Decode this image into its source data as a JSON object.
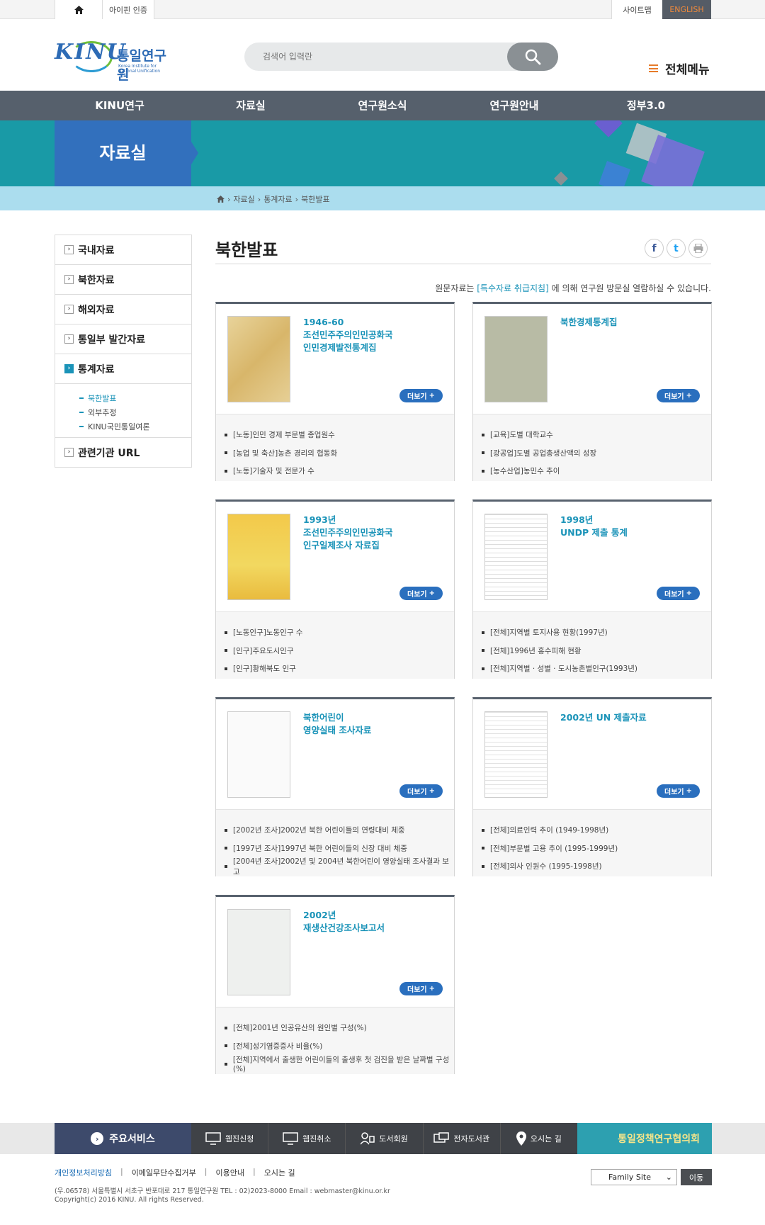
{
  "topbar": {
    "ipin": "아이핀 인증",
    "sitemap": "사이트맵",
    "english": "ENGLISH"
  },
  "header": {
    "logo_text": "KINU",
    "logo_name": "통일연구원",
    "logo_sub": "Korea Institute for National Unification",
    "search_placeholder": "검색어 입력란",
    "all_menu": "전체메뉴"
  },
  "gnb": [
    "KINU연구",
    "자료실",
    "연구원소식",
    "연구원안내",
    "정부3.0"
  ],
  "visual": {
    "title": "자료실"
  },
  "breadcrumb": [
    "자료실",
    "통계자료",
    "북한발표"
  ],
  "lnb": {
    "items": [
      "국내자료",
      "북한자료",
      "해외자료",
      "통일부 발간자료",
      "통계자료",
      "관련기관 URL"
    ],
    "sub": [
      "북한발표",
      "외부추정",
      "KINU국민통일여론"
    ]
  },
  "content": {
    "title": "북한발표",
    "notice_pre": "원문자료는 ",
    "notice_link": "[특수자료 취급지침]",
    "notice_post": " 에 의해 연구원 방문실 열람하실 수 있습니다.",
    "more": "더보기",
    "cards": [
      {
        "title": [
          "1946-60",
          "조선민주주의인민공화국",
          "인민경제발전통계집"
        ],
        "list": [
          "[노동]인민 경제 부문별 종업원수",
          "[농업 및 축산]농촌 경리의 협동화",
          "[노동]기술자 및 전문가 수"
        ]
      },
      {
        "title": [
          "북한경제통계집"
        ],
        "list": [
          "[교육]도별 대학교수",
          "[광공업]도별 공업총생산액의 성장",
          "[농수산업]농민수 추이"
        ]
      },
      {
        "title": [
          "1993년",
          "조선민주주의인민공화국",
          "인구일제조사 자료집"
        ],
        "list": [
          "[노동인구]노동인구 수",
          "[인구]주요도시인구",
          "[인구]황해북도 인구"
        ]
      },
      {
        "title": [
          "1998년",
          "UNDP 제출 통계"
        ],
        "list": [
          "[전체]지역별 토지사용 현황(1997년)",
          "[전체]1996년 홍수피해 현황",
          "[전체]지역별 · 성별 · 도시농촌별인구(1993년)"
        ]
      },
      {
        "title": [
          "북한어린이",
          "영양실태 조사자료"
        ],
        "list": [
          "[2002년 조사]2002년 북한 어린이들의 연령대비 체중",
          "[1997년 조사]1997년 북한 어린이들의 신장 대비 체중",
          "[2004년 조사]2002년 및 2004년 북한어린이 영양실태 조사결과 보고"
        ]
      },
      {
        "title": [
          "2002년 UN 제출자료"
        ],
        "list": [
          "[전체]의료인력 추이 (1949-1998년)",
          "[전체]부문별 고용 추이 (1995-1999년)",
          "[전체]의사 인원수 (1995-1998년)"
        ]
      },
      {
        "title": [
          "2002년",
          "재생산건강조사보고서"
        ],
        "list": [
          "[전체]2001년 인공유산의 원인별 구성(%)",
          "[전체]성기염증증사 비율(%)",
          "[전체]지역에서 출생한 어린이들의 출생후 첫 검진을 받은 날짜별 구성(%)"
        ]
      }
    ]
  },
  "footer": {
    "main_service": "주요서비스",
    "services": [
      "웹진신청",
      "웹진취소",
      "도서회원",
      "전자도서관",
      "오시는 길"
    ],
    "council": "통일정책연구협의회",
    "links": [
      "개인정보처리방침",
      "이메일무단수집거부",
      "이용안내",
      "오시는 길"
    ],
    "address": "(우.06578) 서울특별시 서초구 반포대로 217 통일연구원    TEL : 02)2023-8000    Email : webmaster@kinu.or.kr",
    "copyright": "Copyright(c) 2016 KINU. All rights Reserved.",
    "family_site": "Family Site",
    "go": "이동"
  },
  "colors": {
    "gnb": "#56606c",
    "visual": "#199aa6",
    "accent": "#1a93b8",
    "title_box": "#3270bd"
  }
}
